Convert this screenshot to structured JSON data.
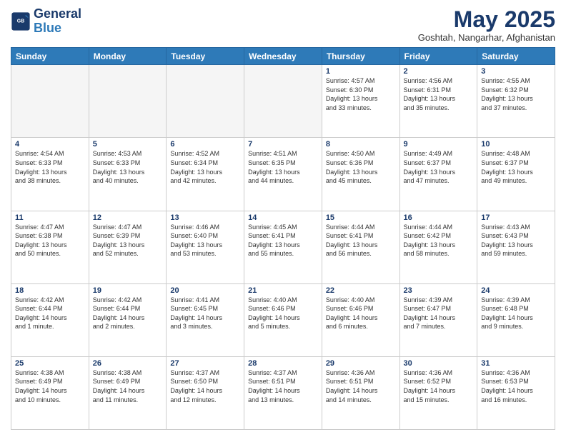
{
  "header": {
    "logo_line1": "General",
    "logo_line2": "Blue",
    "month": "May 2025",
    "location": "Goshtah, Nangarhar, Afghanistan"
  },
  "weekdays": [
    "Sunday",
    "Monday",
    "Tuesday",
    "Wednesday",
    "Thursday",
    "Friday",
    "Saturday"
  ],
  "weeks": [
    [
      {
        "day": "",
        "detail": "",
        "empty": true
      },
      {
        "day": "",
        "detail": "",
        "empty": true
      },
      {
        "day": "",
        "detail": "",
        "empty": true
      },
      {
        "day": "",
        "detail": "",
        "empty": true
      },
      {
        "day": "1",
        "detail": "Sunrise: 4:57 AM\nSunset: 6:30 PM\nDaylight: 13 hours\nand 33 minutes.",
        "empty": false
      },
      {
        "day": "2",
        "detail": "Sunrise: 4:56 AM\nSunset: 6:31 PM\nDaylight: 13 hours\nand 35 minutes.",
        "empty": false
      },
      {
        "day": "3",
        "detail": "Sunrise: 4:55 AM\nSunset: 6:32 PM\nDaylight: 13 hours\nand 37 minutes.",
        "empty": false
      }
    ],
    [
      {
        "day": "4",
        "detail": "Sunrise: 4:54 AM\nSunset: 6:33 PM\nDaylight: 13 hours\nand 38 minutes.",
        "empty": false
      },
      {
        "day": "5",
        "detail": "Sunrise: 4:53 AM\nSunset: 6:33 PM\nDaylight: 13 hours\nand 40 minutes.",
        "empty": false
      },
      {
        "day": "6",
        "detail": "Sunrise: 4:52 AM\nSunset: 6:34 PM\nDaylight: 13 hours\nand 42 minutes.",
        "empty": false
      },
      {
        "day": "7",
        "detail": "Sunrise: 4:51 AM\nSunset: 6:35 PM\nDaylight: 13 hours\nand 44 minutes.",
        "empty": false
      },
      {
        "day": "8",
        "detail": "Sunrise: 4:50 AM\nSunset: 6:36 PM\nDaylight: 13 hours\nand 45 minutes.",
        "empty": false
      },
      {
        "day": "9",
        "detail": "Sunrise: 4:49 AM\nSunset: 6:37 PM\nDaylight: 13 hours\nand 47 minutes.",
        "empty": false
      },
      {
        "day": "10",
        "detail": "Sunrise: 4:48 AM\nSunset: 6:37 PM\nDaylight: 13 hours\nand 49 minutes.",
        "empty": false
      }
    ],
    [
      {
        "day": "11",
        "detail": "Sunrise: 4:47 AM\nSunset: 6:38 PM\nDaylight: 13 hours\nand 50 minutes.",
        "empty": false
      },
      {
        "day": "12",
        "detail": "Sunrise: 4:47 AM\nSunset: 6:39 PM\nDaylight: 13 hours\nand 52 minutes.",
        "empty": false
      },
      {
        "day": "13",
        "detail": "Sunrise: 4:46 AM\nSunset: 6:40 PM\nDaylight: 13 hours\nand 53 minutes.",
        "empty": false
      },
      {
        "day": "14",
        "detail": "Sunrise: 4:45 AM\nSunset: 6:41 PM\nDaylight: 13 hours\nand 55 minutes.",
        "empty": false
      },
      {
        "day": "15",
        "detail": "Sunrise: 4:44 AM\nSunset: 6:41 PM\nDaylight: 13 hours\nand 56 minutes.",
        "empty": false
      },
      {
        "day": "16",
        "detail": "Sunrise: 4:44 AM\nSunset: 6:42 PM\nDaylight: 13 hours\nand 58 minutes.",
        "empty": false
      },
      {
        "day": "17",
        "detail": "Sunrise: 4:43 AM\nSunset: 6:43 PM\nDaylight: 13 hours\nand 59 minutes.",
        "empty": false
      }
    ],
    [
      {
        "day": "18",
        "detail": "Sunrise: 4:42 AM\nSunset: 6:44 PM\nDaylight: 14 hours\nand 1 minute.",
        "empty": false
      },
      {
        "day": "19",
        "detail": "Sunrise: 4:42 AM\nSunset: 6:44 PM\nDaylight: 14 hours\nand 2 minutes.",
        "empty": false
      },
      {
        "day": "20",
        "detail": "Sunrise: 4:41 AM\nSunset: 6:45 PM\nDaylight: 14 hours\nand 3 minutes.",
        "empty": false
      },
      {
        "day": "21",
        "detail": "Sunrise: 4:40 AM\nSunset: 6:46 PM\nDaylight: 14 hours\nand 5 minutes.",
        "empty": false
      },
      {
        "day": "22",
        "detail": "Sunrise: 4:40 AM\nSunset: 6:46 PM\nDaylight: 14 hours\nand 6 minutes.",
        "empty": false
      },
      {
        "day": "23",
        "detail": "Sunrise: 4:39 AM\nSunset: 6:47 PM\nDaylight: 14 hours\nand 7 minutes.",
        "empty": false
      },
      {
        "day": "24",
        "detail": "Sunrise: 4:39 AM\nSunset: 6:48 PM\nDaylight: 14 hours\nand 9 minutes.",
        "empty": false
      }
    ],
    [
      {
        "day": "25",
        "detail": "Sunrise: 4:38 AM\nSunset: 6:49 PM\nDaylight: 14 hours\nand 10 minutes.",
        "empty": false
      },
      {
        "day": "26",
        "detail": "Sunrise: 4:38 AM\nSunset: 6:49 PM\nDaylight: 14 hours\nand 11 minutes.",
        "empty": false
      },
      {
        "day": "27",
        "detail": "Sunrise: 4:37 AM\nSunset: 6:50 PM\nDaylight: 14 hours\nand 12 minutes.",
        "empty": false
      },
      {
        "day": "28",
        "detail": "Sunrise: 4:37 AM\nSunset: 6:51 PM\nDaylight: 14 hours\nand 13 minutes.",
        "empty": false
      },
      {
        "day": "29",
        "detail": "Sunrise: 4:36 AM\nSunset: 6:51 PM\nDaylight: 14 hours\nand 14 minutes.",
        "empty": false
      },
      {
        "day": "30",
        "detail": "Sunrise: 4:36 AM\nSunset: 6:52 PM\nDaylight: 14 hours\nand 15 minutes.",
        "empty": false
      },
      {
        "day": "31",
        "detail": "Sunrise: 4:36 AM\nSunset: 6:53 PM\nDaylight: 14 hours\nand 16 minutes.",
        "empty": false
      }
    ]
  ]
}
